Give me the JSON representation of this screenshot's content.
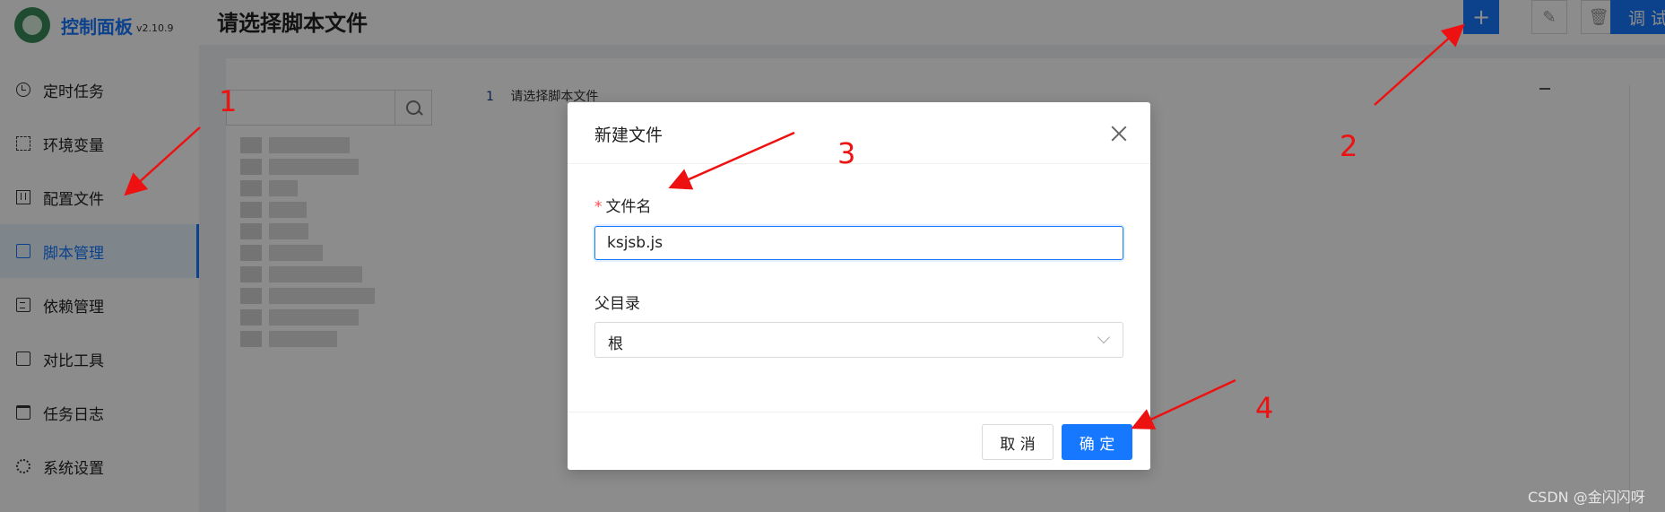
{
  "app": {
    "title": "控制面板",
    "version": "v2.10.9"
  },
  "sidebar": {
    "items": [
      {
        "label": "定时任务",
        "icon": "clock-icon"
      },
      {
        "label": "环境变量",
        "icon": "env-icon"
      },
      {
        "label": "配置文件",
        "icon": "config-icon"
      },
      {
        "label": "脚本管理",
        "icon": "edit-icon",
        "active": true
      },
      {
        "label": "依赖管理",
        "icon": "dependency-icon"
      },
      {
        "label": "对比工具",
        "icon": "diff-icon"
      },
      {
        "label": "任务日志",
        "icon": "folder-icon"
      },
      {
        "label": "系统设置",
        "icon": "gear-icon"
      }
    ]
  },
  "header": {
    "title": "请选择脚本文件",
    "add_label": "+",
    "debug_label": "调 试"
  },
  "editor": {
    "line_number": "1",
    "line_text": "请选择脚本文件"
  },
  "modal": {
    "title": "新建文件",
    "filename_label": "文件名",
    "required_mark": "*",
    "filename_value": "ksjsb.js",
    "parent_label": "父目录",
    "parent_value": "根",
    "cancel_label": "取 消",
    "ok_label": "确 定"
  },
  "annotations": {
    "n1": "1",
    "n2": "2",
    "n3": "3",
    "n4": "4",
    "color": "#ee1111"
  },
  "watermark": "CSDN @金闪闪呀",
  "colors": {
    "primary": "#1677ff",
    "annotation": "#ee1111"
  }
}
